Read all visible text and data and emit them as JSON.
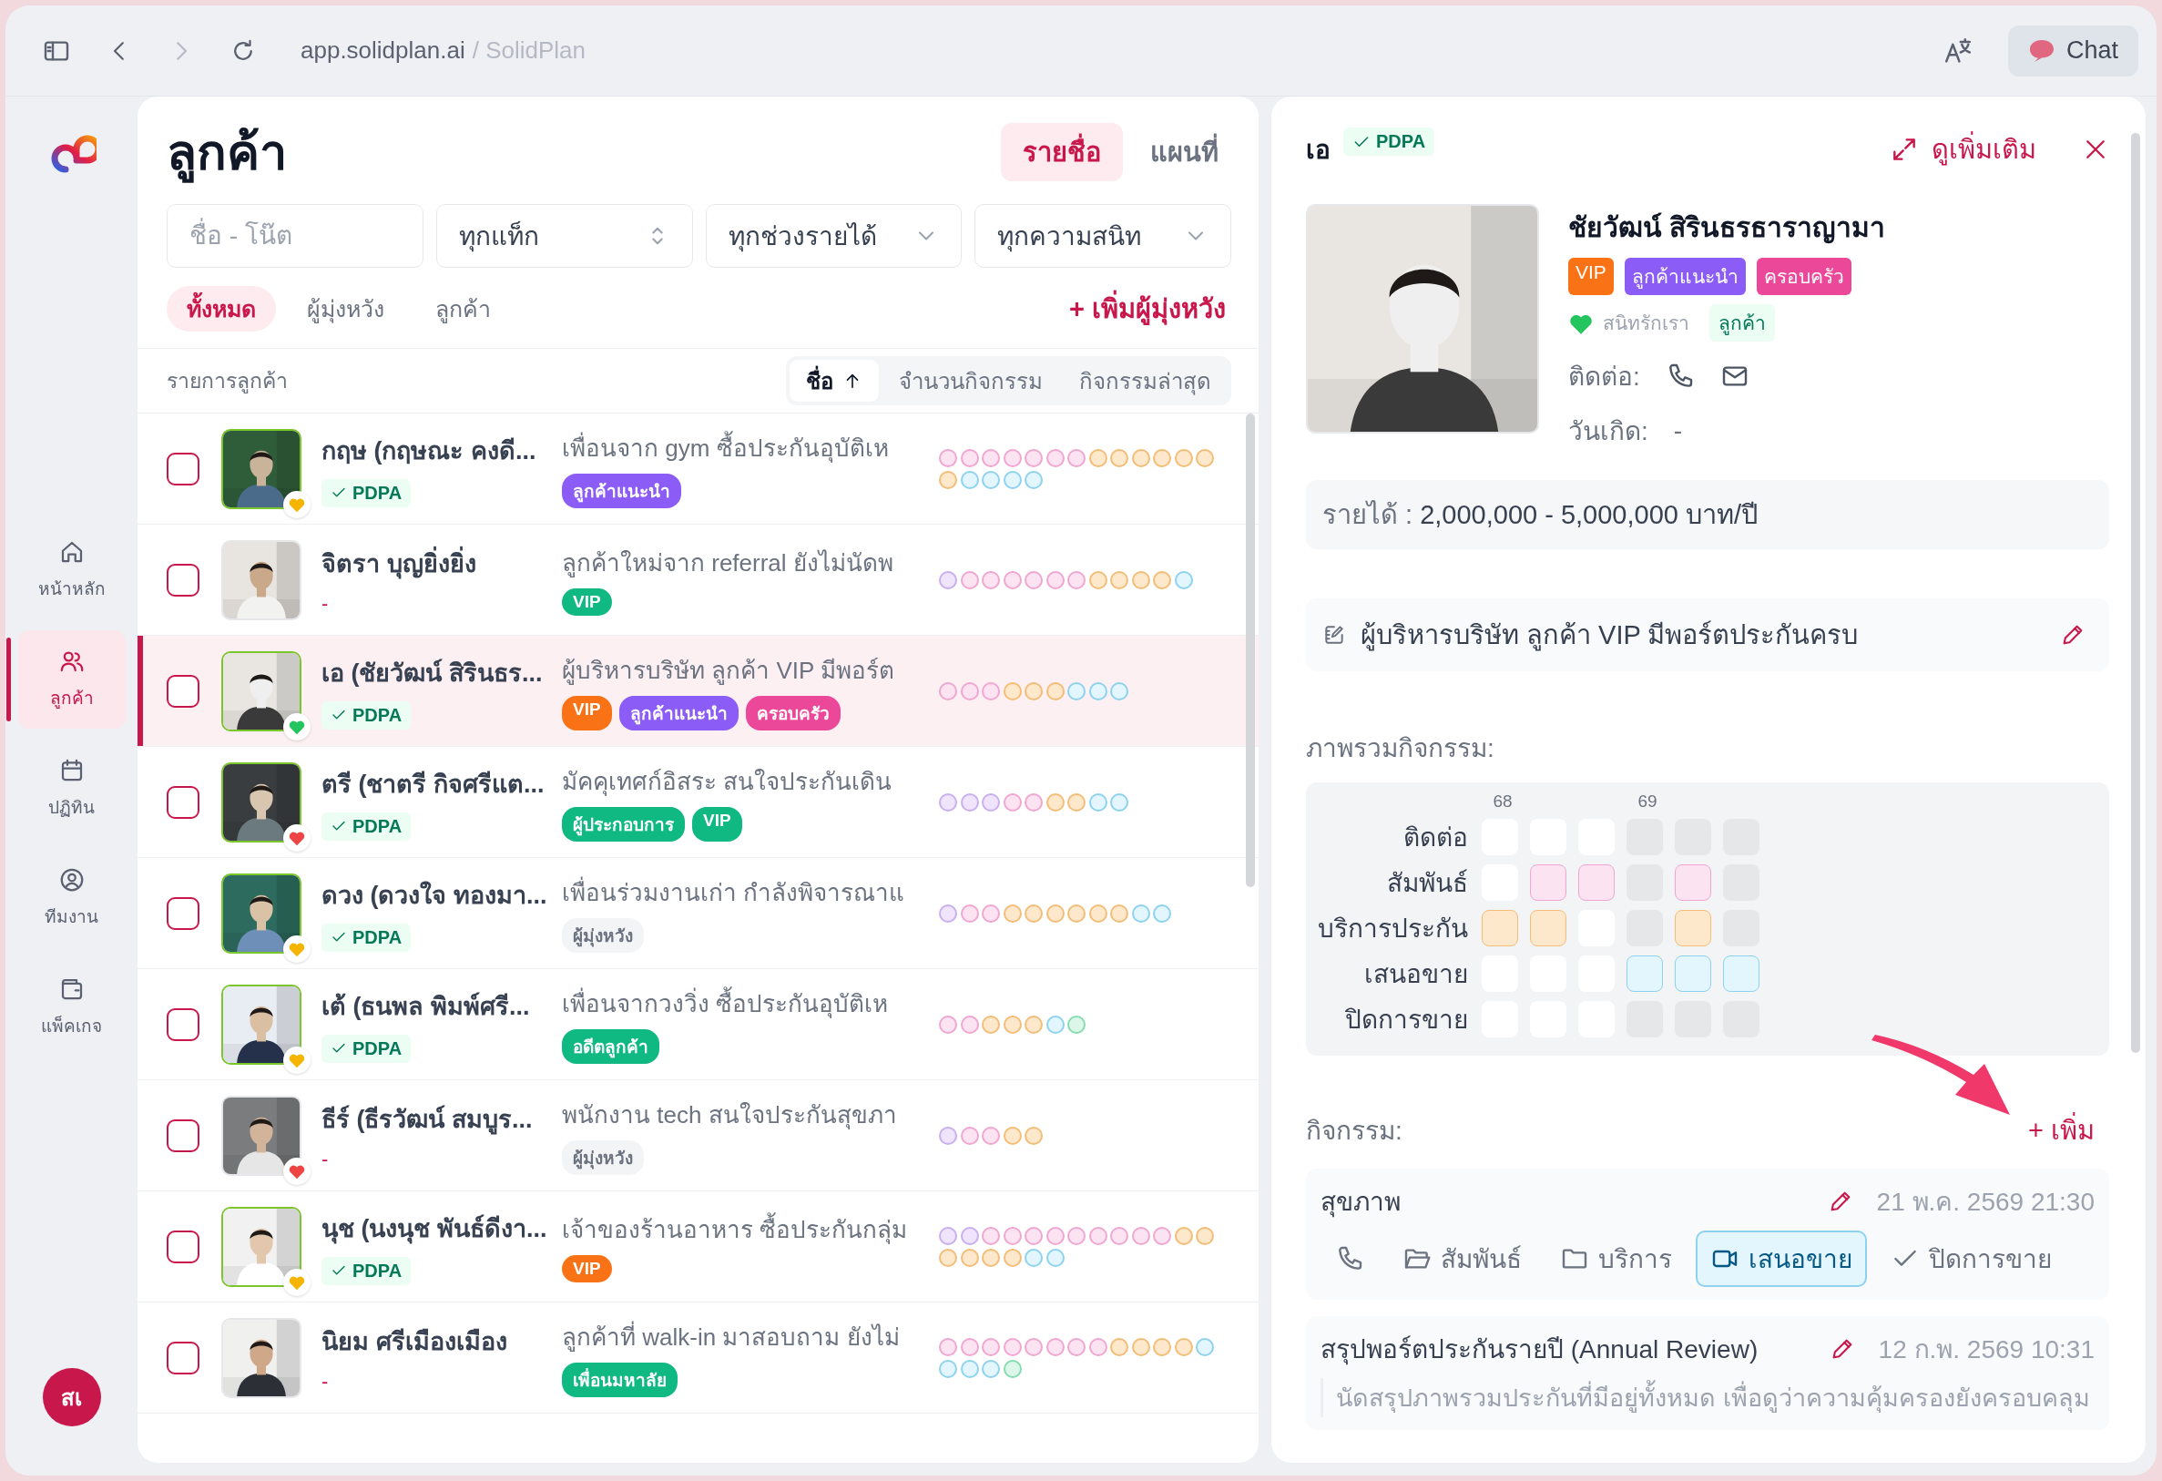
{
  "browser": {
    "host": "app.solidplan.ai",
    "title": "/ SolidPlan",
    "chat": "Chat"
  },
  "sidebar": {
    "items": [
      {
        "label": "หน้าหลัก",
        "selected": false
      },
      {
        "label": "ลูกค้า",
        "selected": true
      },
      {
        "label": "ปฏิทิน",
        "selected": false
      },
      {
        "label": "ทีมงาน",
        "selected": false
      },
      {
        "label": "แพ็คเกจ",
        "selected": false
      }
    ],
    "user_initials": "สเ"
  },
  "customers": {
    "title": "ลูกค้า",
    "views": [
      {
        "label": "รายชื่อ",
        "selected": true
      },
      {
        "label": "แผนที่",
        "selected": false
      }
    ],
    "search_placeholder": "ชื่อ - โน๊ต",
    "selects": [
      {
        "value": "ทุกแท็ก",
        "kind": "updown"
      },
      {
        "value": "ทุกช่วงรายได้",
        "kind": "chevron"
      },
      {
        "value": "ทุกความสนิท",
        "kind": "chevron"
      }
    ],
    "tabs": [
      {
        "label": "ทั้งหมด",
        "selected": true
      },
      {
        "label": "ผู้มุ่งหวัง",
        "selected": false
      },
      {
        "label": "ลูกค้า",
        "selected": false
      }
    ],
    "add_label": "+ เพิ่มผู้มุ่งหวัง",
    "list_title": "รายการลูกค้า",
    "sorts": [
      {
        "label": "ชื่อ",
        "selected": true
      },
      {
        "label": "จำนวนกิจกรรม",
        "selected": false
      },
      {
        "label": "กิจกรรมล่าสุด",
        "selected": false
      }
    ],
    "rows": [
      {
        "name": "กฤษ (กฤษณะ คงดี...",
        "consent": "PDPA",
        "pdpa": true,
        "heart": {
          "color": "#f5b400"
        },
        "checked": false,
        "selected": false,
        "note": "เพื่อนจาก gym ซื้อประกันอุบัติเห",
        "tags": [
          {
            "label": "ลูกค้าแนะนำ",
            "kind": "filled",
            "color": "#8b5cf6"
          }
        ],
        "activities": [
          {
            "kind": "relate"
          },
          {
            "kind": "relate"
          },
          {
            "kind": "relate"
          },
          {
            "kind": "relate"
          },
          {
            "kind": "relate"
          },
          {
            "kind": "relate"
          },
          {
            "kind": "relate"
          },
          {
            "kind": "service"
          },
          {
            "kind": "service"
          },
          {
            "kind": "service"
          },
          {
            "kind": "service"
          },
          {
            "kind": "service"
          },
          {
            "kind": "service"
          },
          {
            "kind": "service"
          },
          {
            "kind": "offer"
          },
          {
            "kind": "offer"
          },
          {
            "kind": "offer"
          },
          {
            "kind": "offer"
          }
        ]
      },
      {
        "name": "จิตรา บุญยิ่งยิ่ง",
        "consent": "-",
        "pdpa": false,
        "checked": false,
        "selected": false,
        "note": "ลูกค้าใหม่จาก referral ยังไม่นัดพ",
        "tags": [
          {
            "label": "VIP",
            "kind": "filled",
            "color": "#10b981"
          }
        ],
        "activities": [
          {
            "kind": "contact"
          },
          {
            "kind": "relate"
          },
          {
            "kind": "relate"
          },
          {
            "kind": "relate"
          },
          {
            "kind": "relate"
          },
          {
            "kind": "relate"
          },
          {
            "kind": "relate"
          },
          {
            "kind": "service"
          },
          {
            "kind": "service"
          },
          {
            "kind": "service"
          },
          {
            "kind": "service"
          },
          {
            "kind": "offer"
          }
        ]
      },
      {
        "name": "เอ (ชัยวัฒน์ สิรินธร...",
        "consent": "PDPA",
        "pdpa": true,
        "heart": {
          "color": "#22c55e"
        },
        "checked": false,
        "selected": true,
        "note": "ผู้บริหารบริษัท ลูกค้า VIP มีพอร์ต",
        "tags": [
          {
            "label": "VIP",
            "kind": "filled",
            "color": "#f97316"
          },
          {
            "label": "ลูกค้าแนะนำ",
            "kind": "filled",
            "color": "#8b5cf6"
          },
          {
            "label": "ครอบครัว",
            "kind": "filled",
            "color": "#ec4899"
          }
        ],
        "activities": [
          {
            "kind": "relate"
          },
          {
            "kind": "relate"
          },
          {
            "kind": "relate"
          },
          {
            "kind": "service"
          },
          {
            "kind": "service"
          },
          {
            "kind": "service"
          },
          {
            "kind": "offer"
          },
          {
            "kind": "offer"
          },
          {
            "kind": "offer"
          }
        ]
      },
      {
        "name": "ตรี (ชาตรี กิจศรีแต...",
        "consent": "PDPA",
        "pdpa": true,
        "heart": {
          "color": "#ef4444"
        },
        "checked": false,
        "selected": false,
        "note": "มัคคุเทศก์อิสระ สนใจประกันเดิน",
        "tags": [
          {
            "label": "ผู้ประกอบการ",
            "kind": "filled",
            "color": "#10b981"
          },
          {
            "label": "VIP",
            "kind": "filled",
            "color": "#10b981"
          }
        ],
        "activities": [
          {
            "kind": "contact"
          },
          {
            "kind": "contact"
          },
          {
            "kind": "contact"
          },
          {
            "kind": "relate"
          },
          {
            "kind": "relate"
          },
          {
            "kind": "service"
          },
          {
            "kind": "service"
          },
          {
            "kind": "offer"
          },
          {
            "kind": "offer"
          }
        ]
      },
      {
        "name": "ดวง (ดวงใจ ทองมา...",
        "consent": "PDPA",
        "pdpa": true,
        "heart": {
          "color": "#f5b400"
        },
        "checked": false,
        "selected": false,
        "note": "เพื่อนร่วมงานเก่า กำลังพิจารณาแ",
        "tags": [
          {
            "label": "ผู้มุ่งหวัง",
            "kind": "muted"
          }
        ],
        "activities": [
          {
            "kind": "contact"
          },
          {
            "kind": "relate"
          },
          {
            "kind": "relate"
          },
          {
            "kind": "service"
          },
          {
            "kind": "service"
          },
          {
            "kind": "service"
          },
          {
            "kind": "service"
          },
          {
            "kind": "service"
          },
          {
            "kind": "service"
          },
          {
            "kind": "offer"
          },
          {
            "kind": "offer"
          }
        ]
      },
      {
        "name": "เต้ (ธนพล พิมพ์ศรี...",
        "consent": "PDPA",
        "pdpa": true,
        "heart": {
          "color": "#f5b400"
        },
        "checked": false,
        "selected": false,
        "note": "เพื่อนจากวงวิ่ง ซื้อประกันอุบัติเห",
        "tags": [
          {
            "label": "อดีตลูกค้า",
            "kind": "filled",
            "color": "#10b981"
          }
        ],
        "activities": [
          {
            "kind": "relate"
          },
          {
            "kind": "relate"
          },
          {
            "kind": "service"
          },
          {
            "kind": "service"
          },
          {
            "kind": "service"
          },
          {
            "kind": "offer"
          },
          {
            "kind": "close"
          }
        ]
      },
      {
        "name": "ธีร์ (ธีรวัฒน์ สมบูร...",
        "consent": "-",
        "pdpa": false,
        "heart": {
          "color": "#ef4444"
        },
        "checked": false,
        "selected": false,
        "note": "พนักงาน tech สนใจประกันสุขภา",
        "tags": [
          {
            "label": "ผู้มุ่งหวัง",
            "kind": "muted"
          }
        ],
        "activities": [
          {
            "kind": "contact"
          },
          {
            "kind": "relate"
          },
          {
            "kind": "relate"
          },
          {
            "kind": "service"
          },
          {
            "kind": "service"
          }
        ]
      },
      {
        "name": "นุช (นงนุช พันธ์ดีงา...",
        "consent": "PDPA",
        "pdpa": true,
        "heart": {
          "color": "#f5b400"
        },
        "checked": false,
        "selected": false,
        "note": "เจ้าของร้านอาหาร ซื้อประกันกลุ่ม",
        "tags": [
          {
            "label": "VIP",
            "kind": "filled",
            "color": "#f97316"
          }
        ],
        "activities": [
          {
            "kind": "contact"
          },
          {
            "kind": "contact"
          },
          {
            "kind": "relate"
          },
          {
            "kind": "relate"
          },
          {
            "kind": "relate"
          },
          {
            "kind": "relate"
          },
          {
            "kind": "relate"
          },
          {
            "kind": "relate"
          },
          {
            "kind": "relate"
          },
          {
            "kind": "relate"
          },
          {
            "kind": "relate"
          },
          {
            "kind": "service"
          },
          {
            "kind": "service"
          },
          {
            "kind": "service"
          },
          {
            "kind": "service"
          },
          {
            "kind": "service"
          },
          {
            "kind": "service"
          },
          {
            "kind": "offer"
          },
          {
            "kind": "offer"
          }
        ]
      },
      {
        "name": "นิยม ศรีเมืองเมือง",
        "consent": "-",
        "pdpa": false,
        "checked": false,
        "selected": false,
        "note": "ลูกค้าที่ walk-in มาสอบถาม ยังไม่",
        "tags": [
          {
            "label": "เพื่อนมหาลัย",
            "kind": "filled",
            "color": "#10b981"
          }
        ],
        "activities": [
          {
            "kind": "relate"
          },
          {
            "kind": "relate"
          },
          {
            "kind": "relate"
          },
          {
            "kind": "relate"
          },
          {
            "kind": "relate"
          },
          {
            "kind": "relate"
          },
          {
            "kind": "relate"
          },
          {
            "kind": "relate"
          },
          {
            "kind": "service"
          },
          {
            "kind": "service"
          },
          {
            "kind": "service"
          },
          {
            "kind": "service"
          },
          {
            "kind": "offer"
          },
          {
            "kind": "offer"
          },
          {
            "kind": "offer"
          },
          {
            "kind": "offer"
          },
          {
            "kind": "close"
          }
        ]
      }
    ]
  },
  "detail": {
    "nickname": "เอ",
    "consent": "PDPA",
    "more_label": "ดูเพิ่มเติม",
    "name": "ชัยวัฒน์ สิรินธรธาราญามา",
    "tags": [
      {
        "label": "VIP",
        "color": "#f97316"
      },
      {
        "label": "ลูกค้าแนะนำ",
        "color": "#8b5cf6"
      },
      {
        "label": "ครอบครัว",
        "color": "#ec4899"
      }
    ],
    "closeness": {
      "label": "สนิทรักเรา",
      "color": "#22c55e"
    },
    "status": "ลูกค้า",
    "contact_label": "ติดต่อ:",
    "birthday_label": "วันเกิด:",
    "birthday": "-",
    "income_label": "รายได้ :",
    "income": "2,000,000 - 5,000,000 บาท/ปี",
    "note": "ผู้บริหารบริษัท ลูกค้า VIP มีพอร์ตประกันครบ",
    "overview_label": "ภาพรวมกิจกรรม:",
    "heatmap": {
      "columns": [
        {
          "label": "68",
          "shaded": false
        },
        {
          "shaded": false
        },
        {
          "shaded": false
        },
        {
          "label": "69",
          "shaded": true
        },
        {
          "shaded": true
        },
        {
          "shaded": true
        }
      ],
      "rows": [
        {
          "label": "ติดต่อ",
          "kind": "contact",
          "filled": [
            false,
            false,
            false,
            false,
            false,
            false
          ]
        },
        {
          "label": "สัมพันธ์",
          "kind": "relate",
          "filled": [
            false,
            true,
            true,
            false,
            true,
            false
          ]
        },
        {
          "label": "บริการประกัน",
          "kind": "service",
          "filled": [
            true,
            true,
            false,
            false,
            true,
            false
          ]
        },
        {
          "label": "เสนอขาย",
          "kind": "offer",
          "filled": [
            false,
            false,
            false,
            true,
            true,
            true
          ]
        },
        {
          "label": "ปิดการขาย",
          "kind": "close",
          "filled": [
            false,
            false,
            false,
            false,
            false,
            false
          ]
        }
      ]
    },
    "activities_label": "กิจกรรม:",
    "add_label": "+ เพิ่ม",
    "activities": [
      {
        "title": "สุขภาพ",
        "date": "21 พ.ค. 2569 21:30",
        "stages": [
          {
            "kind": "call",
            "selected": false
          },
          {
            "kind": "relate",
            "label": "สัมพันธ์",
            "selected": false
          },
          {
            "kind": "service",
            "label": "บริการ",
            "selected": false
          },
          {
            "kind": "offer",
            "label": "เสนอขาย",
            "selected": true
          },
          {
            "kind": "close",
            "label": "ปิดการขาย",
            "selected": false
          }
        ]
      },
      {
        "title": "สรุปพอร์ตประกันรายปี (Annual Review)",
        "date": "12 ก.พ. 2569 10:31",
        "description": "นัดสรุปภาพรวมประกันที่มีอยู่ทั้งหมด เพื่อดูว่าความคุ้มครองยังครอบคลุม"
      }
    ]
  }
}
